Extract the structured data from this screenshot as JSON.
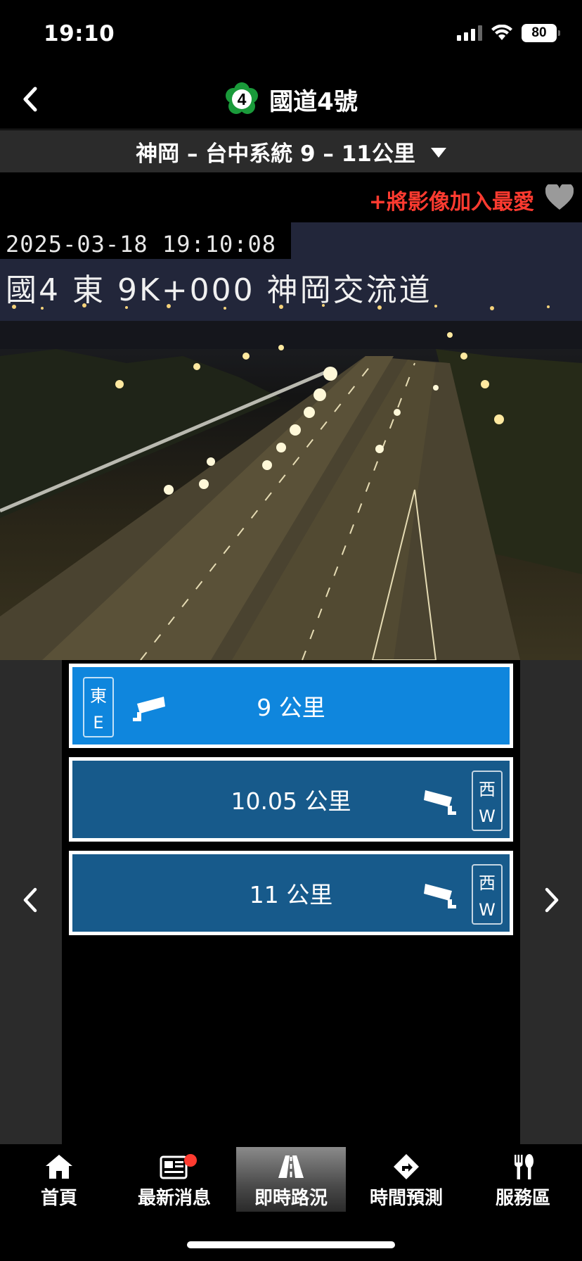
{
  "status_bar": {
    "time": "19:10",
    "battery": "80"
  },
  "header": {
    "route_number": "4",
    "title": "國道4號"
  },
  "section": {
    "label": "神岡 – 台中系統 9 – 11公里"
  },
  "favorite": {
    "label": "+將影像加入最愛"
  },
  "camera": {
    "timestamp": "2025-03-18 19:10:08",
    "location": "國4 東 9K+000 神岡交流道"
  },
  "cameras": [
    {
      "label": "9 公里",
      "dir_cn": "東",
      "dir_en": "E",
      "selected": true
    },
    {
      "label": "10.05 公里",
      "dir_cn": "西",
      "dir_en": "W",
      "selected": false
    },
    {
      "label": "11 公里",
      "dir_cn": "西",
      "dir_en": "W",
      "selected": false
    }
  ],
  "tabs": [
    {
      "label": "首頁",
      "icon": "home-icon"
    },
    {
      "label": "最新消息",
      "icon": "news-icon"
    },
    {
      "label": "即時路況",
      "icon": "road-icon",
      "selected": true
    },
    {
      "label": "時間預測",
      "icon": "direction-icon"
    },
    {
      "label": "服務區",
      "icon": "utensils-icon"
    }
  ],
  "colors": {
    "active": "#0f86dd",
    "inactive": "#175a8b",
    "favorite": "#ff3b30",
    "badge": "#1a9a3a"
  }
}
